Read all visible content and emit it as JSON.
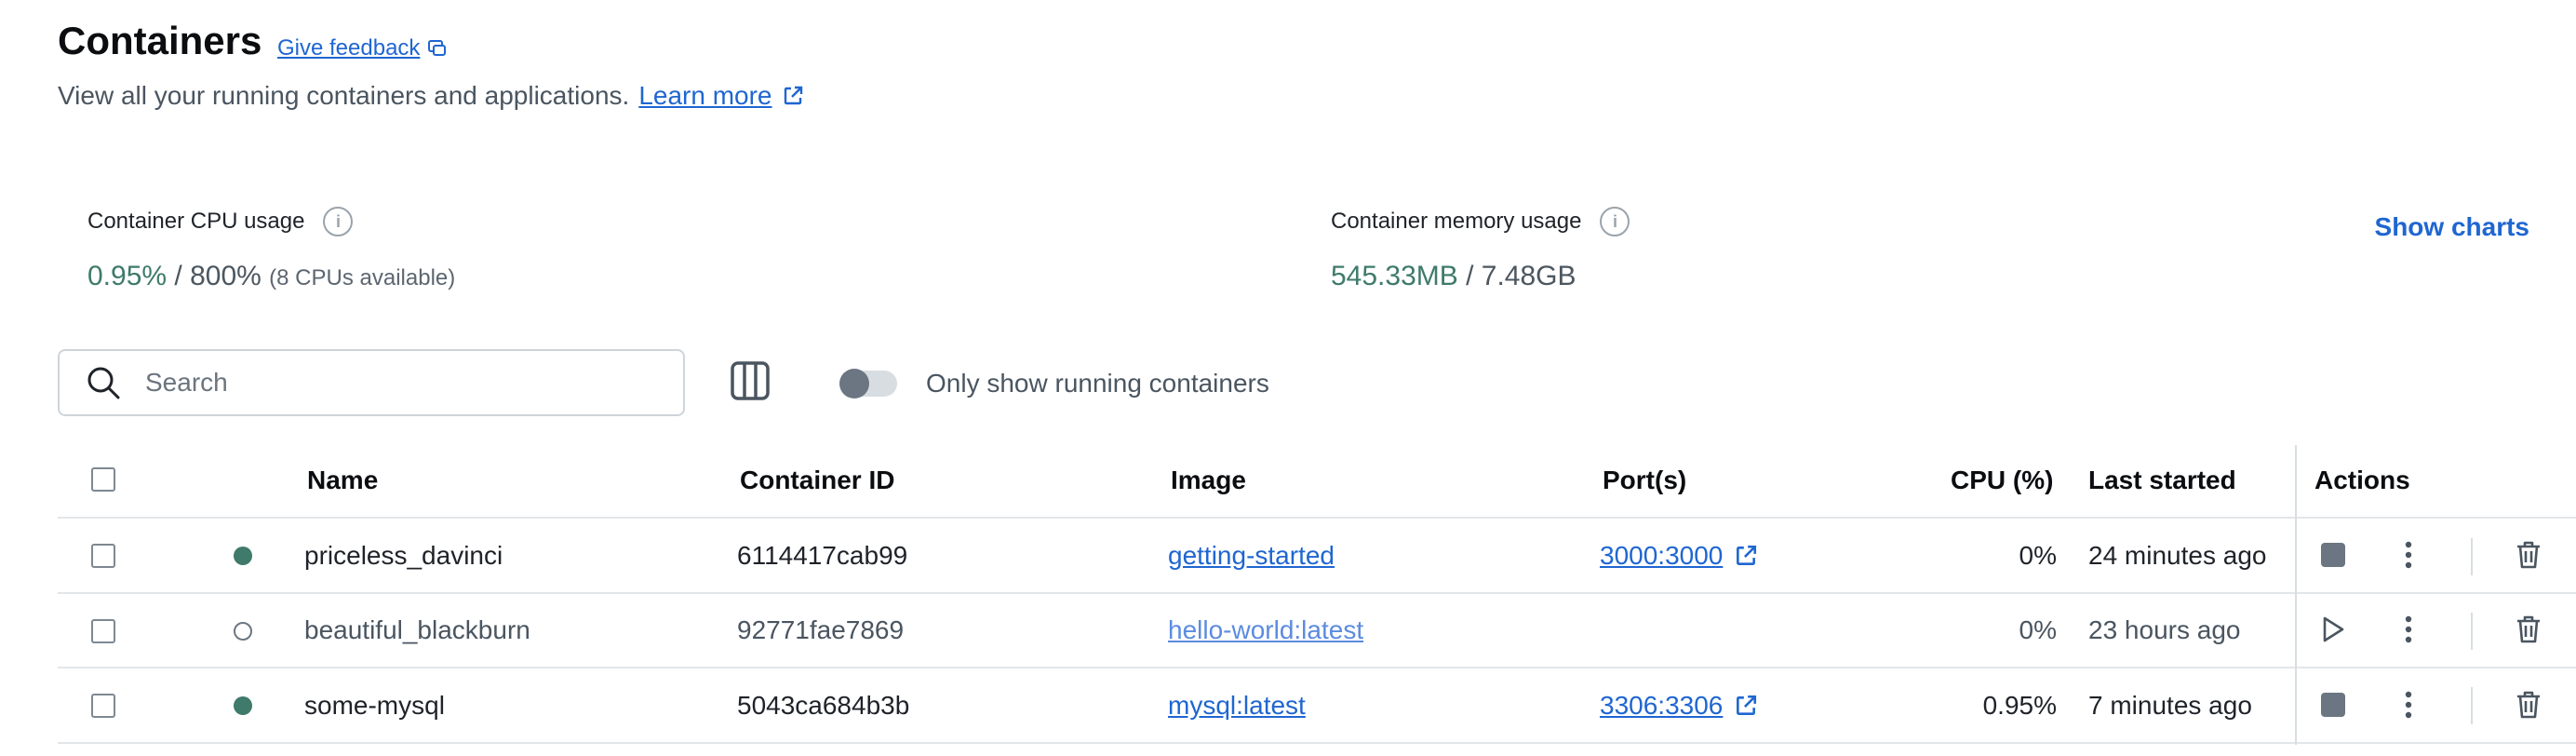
{
  "header": {
    "title": "Containers",
    "feedback_label": "Give feedback",
    "subtitle": "View all your running containers and applications.",
    "learn_more": "Learn more"
  },
  "stats": {
    "cpu": {
      "label": "Container CPU usage",
      "used": "0.95%",
      "separator": " / ",
      "total": "800%",
      "note": "(8 CPUs available)"
    },
    "memory": {
      "label": "Container memory usage",
      "used": "545.33MB",
      "separator": " / ",
      "total": "7.48GB"
    },
    "show_charts": "Show charts"
  },
  "toolbar": {
    "search_placeholder": "Search",
    "toggle_label": "Only show running containers",
    "toggle_on": false
  },
  "table": {
    "columns": {
      "name": "Name",
      "container_id": "Container ID",
      "image": "Image",
      "ports": "Port(s)",
      "cpu": "CPU (%)",
      "last_started": "Last started",
      "actions": "Actions"
    },
    "rows": [
      {
        "status": "running",
        "name": "priceless_davinci",
        "container_id": "6114417cab99",
        "image": "getting-started",
        "ports": "3000:3000",
        "cpu": "0%",
        "last_started": "24 minutes ago",
        "primary_action": "stop"
      },
      {
        "status": "stopped",
        "name": "beautiful_blackburn",
        "container_id": "92771fae7869",
        "image": "hello-world:latest",
        "ports": "",
        "cpu": "0%",
        "last_started": "23 hours ago",
        "primary_action": "start"
      },
      {
        "status": "running",
        "name": "some-mysql",
        "container_id": "5043ca684b3b",
        "image": "mysql:latest",
        "ports": "3306:3306",
        "cpu": "0.95%",
        "last_started": "7 minutes ago",
        "primary_action": "stop"
      }
    ]
  },
  "colors": {
    "accent": "#1f66d1",
    "running": "#3f7a6b",
    "muted": "#6b7682"
  }
}
